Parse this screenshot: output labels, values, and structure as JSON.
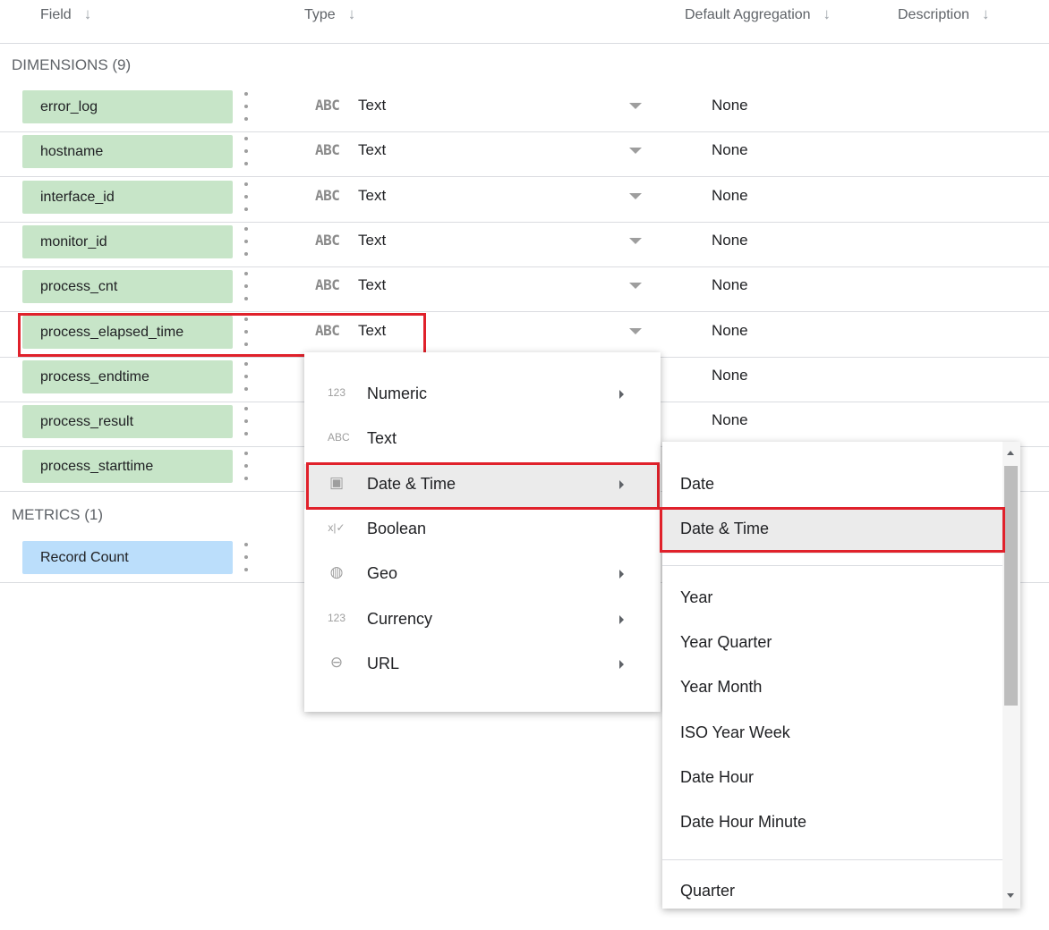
{
  "header": {
    "field": "Field",
    "type": "Type",
    "default_aggregation": "Default Aggregation",
    "description": "Description",
    "sort_icon": "arrow-down-icon"
  },
  "dimensions_label": "DIMENSIONS (9)",
  "metrics_label": "METRICS (1)",
  "dimensions": [
    {
      "name": "error_log",
      "type": "Text",
      "type_icon": "ABC",
      "aggregation": "None"
    },
    {
      "name": "hostname",
      "type": "Text",
      "type_icon": "ABC",
      "aggregation": "None"
    },
    {
      "name": "interface_id",
      "type": "Text",
      "type_icon": "ABC",
      "aggregation": "None"
    },
    {
      "name": "monitor_id",
      "type": "Text",
      "type_icon": "ABC",
      "aggregation": "None"
    },
    {
      "name": "process_cnt",
      "type": "Text",
      "type_icon": "ABC",
      "aggregation": "None"
    },
    {
      "name": "process_elapsed_time",
      "type": "Text",
      "type_icon": "ABC",
      "aggregation": "None"
    },
    {
      "name": "process_endtime",
      "aggregation": "None"
    },
    {
      "name": "process_result",
      "aggregation": "None"
    },
    {
      "name": "process_starttime"
    }
  ],
  "metrics": [
    {
      "name": "Record Count"
    }
  ],
  "type_menu": [
    {
      "icon": "123",
      "label": "Numeric",
      "has_submenu": true
    },
    {
      "icon": "ABC",
      "label": "Text",
      "has_submenu": false
    },
    {
      "icon": "calendar-icon",
      "label": "Date & Time",
      "has_submenu": true,
      "highlighted": true
    },
    {
      "icon": "x|✓",
      "label": "Boolean",
      "has_submenu": false
    },
    {
      "icon": "globe-icon",
      "label": "Geo",
      "has_submenu": true
    },
    {
      "icon": "123",
      "label": "Currency",
      "has_submenu": true
    },
    {
      "icon": "link-icon",
      "label": "URL",
      "has_submenu": true
    }
  ],
  "datetime_submenu": {
    "group1": [
      "Date",
      "Date & Time"
    ],
    "group2": [
      "Year",
      "Year Quarter",
      "Year Month",
      "ISO Year Week",
      "Date Hour",
      "Date Hour Minute"
    ],
    "group3": [
      "Quarter"
    ],
    "highlighted": "Date & Time"
  },
  "colors": {
    "dimension_chip": "#c7e5c8",
    "metric_chip": "#bbdefb",
    "highlight_border": "#e0212b"
  }
}
